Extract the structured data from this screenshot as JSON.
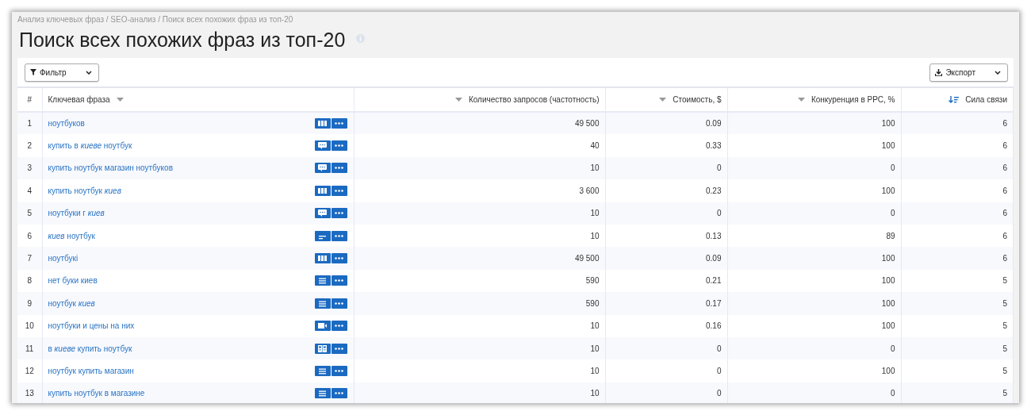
{
  "breadcrumb": "Анализ ключевых фраз / SEO-анализ / Поиск всех похожих фраз из топ-20",
  "title": "Поиск всех похожих фраз из топ-20",
  "toolbar": {
    "filter_button": "Фильтр",
    "export_button": "Экспорт"
  },
  "table": {
    "columns": [
      {
        "label": "#",
        "kind": "plain"
      },
      {
        "label": "Ключевая фраза",
        "kind": "sortable",
        "sorted": false
      },
      {
        "label": "Количество запросов (частотность)",
        "kind": "sortable",
        "sorted": false
      },
      {
        "label": "Стоимость, $",
        "kind": "sortable",
        "sorted": false
      },
      {
        "label": "Конкуренция в PPC, %",
        "kind": "sortable",
        "sorted": false
      },
      {
        "label": "Сила связи",
        "kind": "sortable",
        "sorted": true
      }
    ],
    "rows": [
      {
        "num": "1",
        "phrase": "ноутбуков",
        "kind": "columns",
        "count": "49 500",
        "cost": "0.09",
        "competition": "100",
        "strength": "6"
      },
      {
        "num": "2",
        "phrase": "купить в *киеве* ноутбук",
        "kind": "chat",
        "count": "40",
        "cost": "0.33",
        "competition": "100",
        "strength": "6"
      },
      {
        "num": "3",
        "phrase": "купить ноутбук магазин ноутбуков",
        "kind": "chat",
        "count": "10",
        "cost": "0",
        "competition": "0",
        "strength": "6"
      },
      {
        "num": "4",
        "phrase": "купить ноутбук *киев*",
        "kind": "columns",
        "count": "3 600",
        "cost": "0.23",
        "competition": "100",
        "strength": "6"
      },
      {
        "num": "5",
        "phrase": "ноутбуки г *киев*",
        "kind": "chat",
        "count": "10",
        "cost": "0",
        "competition": "0",
        "strength": "6"
      },
      {
        "num": "6",
        "phrase": "*киев* ноутбук",
        "kind": "short-lines",
        "count": "10",
        "cost": "0.13",
        "competition": "89",
        "strength": "6"
      },
      {
        "num": "7",
        "phrase": "ноутбукі",
        "kind": "columns",
        "count": "49 500",
        "cost": "0.09",
        "competition": "100",
        "strength": "6"
      },
      {
        "num": "8",
        "phrase": "нет буки киев",
        "kind": "list",
        "count": "590",
        "cost": "0.21",
        "competition": "100",
        "strength": "5"
      },
      {
        "num": "9",
        "phrase": "ноутбук *киев*",
        "kind": "list",
        "count": "590",
        "cost": "0.17",
        "competition": "100",
        "strength": "5"
      },
      {
        "num": "10",
        "phrase": "ноутбуки и цены на них",
        "kind": "video",
        "count": "10",
        "cost": "0.16",
        "competition": "100",
        "strength": "5"
      },
      {
        "num": "11",
        "phrase": "в *киеве* купить ноутбук",
        "kind": "images",
        "count": "10",
        "cost": "0",
        "competition": "0",
        "strength": "5"
      },
      {
        "num": "12",
        "phrase": "ноутбук купить магазин",
        "kind": "list",
        "count": "10",
        "cost": "0",
        "competition": "100",
        "strength": "5"
      },
      {
        "num": "13",
        "phrase": "купить ноутбук в магазине",
        "kind": "list",
        "count": "10",
        "cost": "0",
        "competition": "0",
        "strength": "5"
      }
    ]
  }
}
